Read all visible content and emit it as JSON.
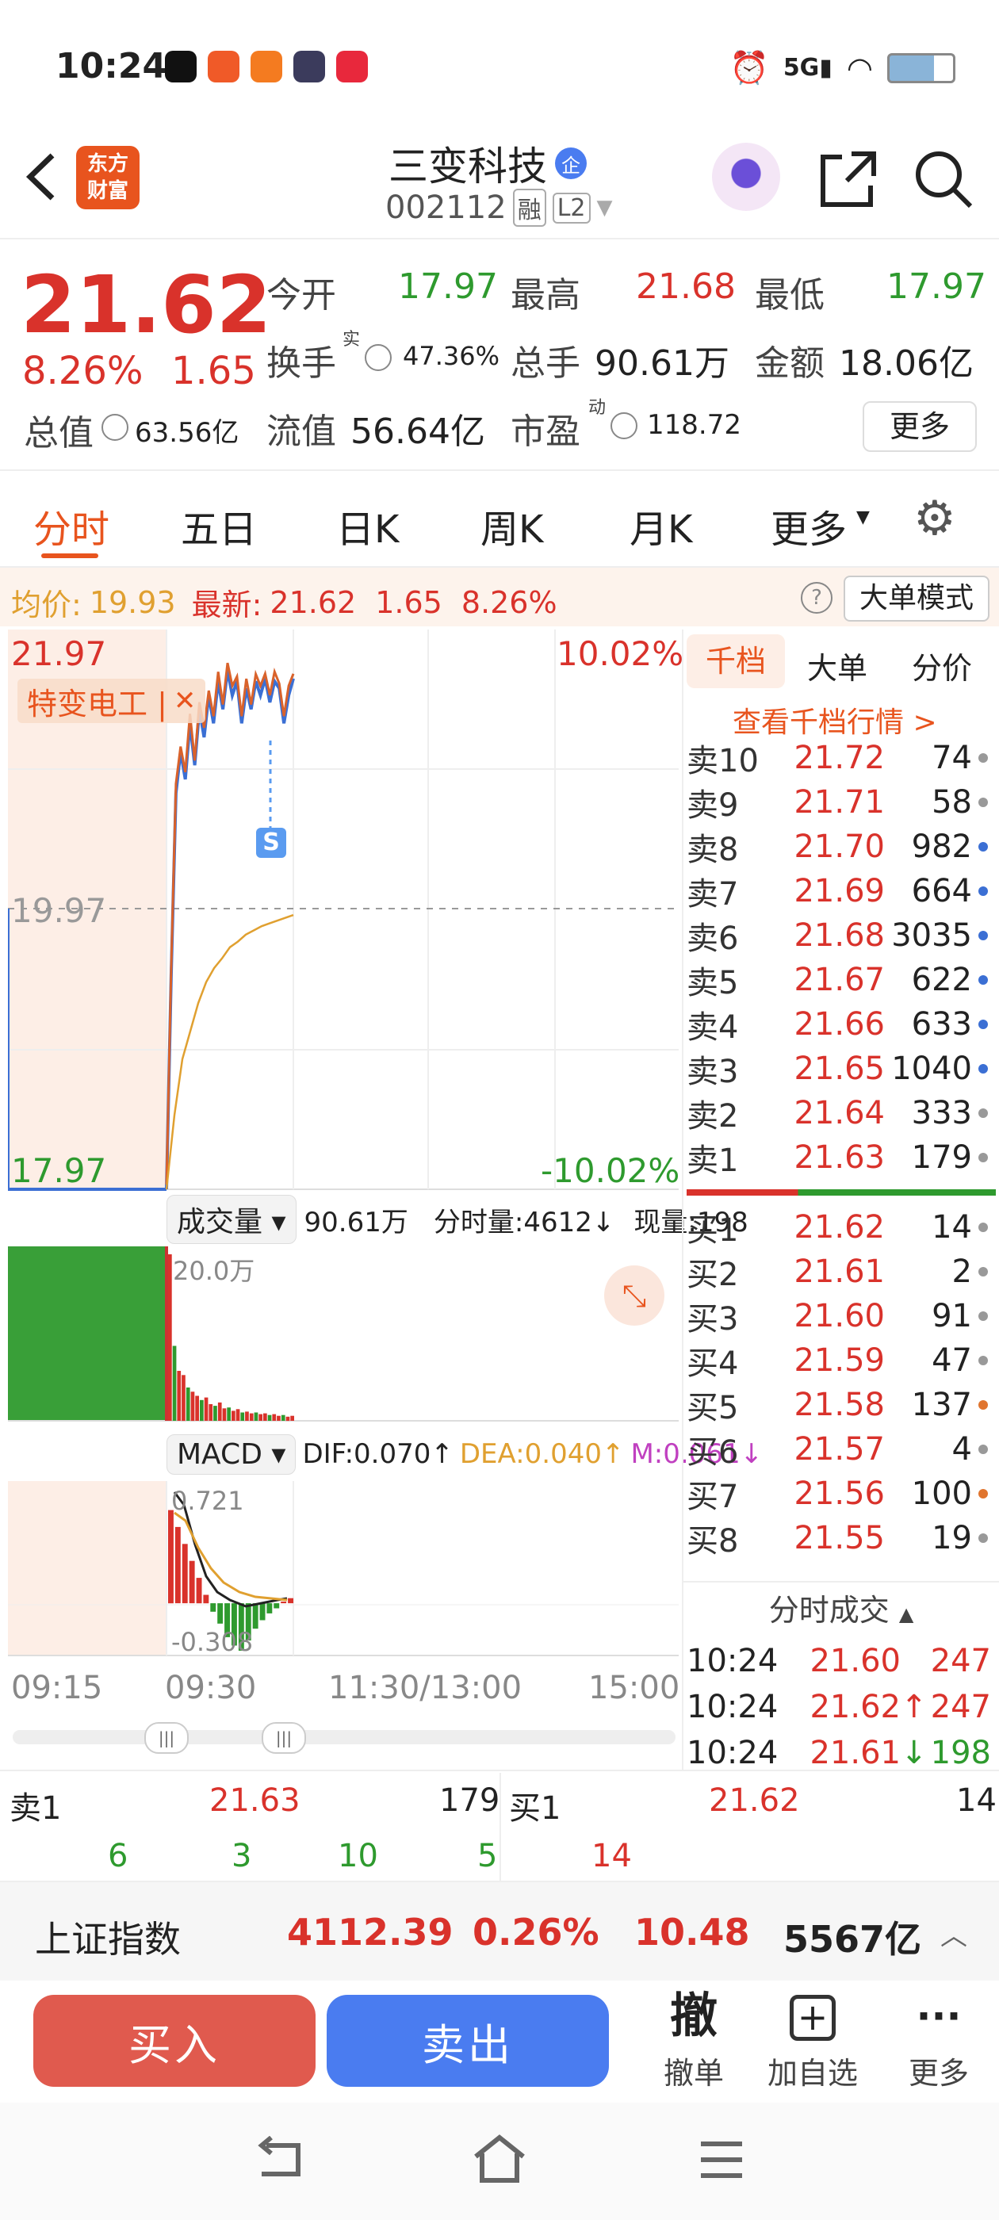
{
  "status_bar": {
    "time": "10:24",
    "app_icons": [
      "douyin-icon",
      "app-red-icon",
      "app-orange-icon",
      "k-app-icon",
      "xiaohongshu-icon"
    ],
    "right_icons": [
      "alarm-icon",
      "signal-5g-icon",
      "wifi-icon",
      "battery-icon"
    ]
  },
  "header": {
    "brand_line1": "东方",
    "brand_line2": "财富",
    "stock_name": "三变科技",
    "badge": "企",
    "code": "002112",
    "tag1": "融",
    "tag2": "L2"
  },
  "quote": {
    "price": "21.62",
    "pct": "8.26%",
    "change": "1.65",
    "open_label": "今开",
    "open": "17.97",
    "high_label": "最高",
    "high": "21.68",
    "low_label": "最低",
    "low": "17.97",
    "turnover_label": "换手",
    "turnover_sup": "实",
    "turnover": "47.36%",
    "volume_label": "总手",
    "volume": "90.61万",
    "amount_label": "金额",
    "amount": "18.06亿",
    "mcap_label": "总值",
    "mcap": "63.56亿",
    "float_label": "流值",
    "float": "56.64亿",
    "pe_label": "市盈",
    "pe_sup": "动",
    "pe": "118.72",
    "more": "更多"
  },
  "tabs": [
    "分时",
    "五日",
    "日K",
    "周K",
    "月K",
    "更多"
  ],
  "tab_active": 0,
  "info_bar": {
    "avg_label": "均价:",
    "avg": "19.93",
    "latest_label": "最新:",
    "latest": "21.62",
    "latest_change": "1.65",
    "latest_pct": "8.26%",
    "mode_button": "大单模式"
  },
  "chart": {
    "top_price": "21.97",
    "mid_price": "19.97",
    "bottom_price": "17.97",
    "top_pct": "10.02%",
    "bottom_pct": "-10.02%",
    "related_tag": "特变电工 |",
    "signal": "S",
    "x_labels": [
      "09:15",
      "09:30",
      "11:30/13:00",
      "15:00"
    ]
  },
  "chart_data": [
    {
      "type": "line",
      "title": "",
      "series": [
        {
          "name": "",
          "x": [
            "09:30",
            "09:32",
            "09:34",
            "09:36",
            "09:38",
            "09:40",
            "09:42",
            "09:44",
            "09:46",
            "09:48",
            "09:50",
            "09:52",
            "09:54",
            "09:56",
            "09:58",
            "10:00",
            "10:02",
            "10:04",
            "10:06",
            "10:08",
            "10:10",
            "10:12",
            "10:14",
            "10:16",
            "10:18",
            "10:20",
            "10:22",
            "10:24"
          ],
          "values": [
            17.97,
            19.5,
            20.8,
            21.1,
            20.9,
            21.3,
            21.0,
            21.4,
            21.2,
            21.5,
            21.3,
            21.6,
            21.4,
            21.68,
            21.5,
            21.6,
            21.3,
            21.55,
            21.4,
            21.6,
            21.5,
            21.62,
            21.45,
            21.6,
            21.55,
            21.3,
            21.5,
            21.62
          ]
        },
        {
          "name": "",
          "x": [
            "09:30",
            "09:32",
            "09:34",
            "09:36",
            "09:38",
            "09:40",
            "09:44",
            "09:48",
            "09:52",
            "09:56",
            "10:00",
            "10:04",
            "10:08",
            "10:12",
            "10:16",
            "10:20",
            "10:24"
          ],
          "values": [
            17.97,
            18.5,
            18.9,
            19.1,
            19.3,
            19.45,
            19.55,
            19.62,
            19.7,
            19.74,
            19.79,
            19.82,
            19.85,
            19.87,
            19.89,
            19.91,
            19.93
          ]
        }
      ],
      "ylim": [
        17.97,
        21.97
      ],
      "yticks": [
        "21.97",
        "19.97",
        "17.97"
      ]
    },
    {
      "type": "bar",
      "title": "成交量",
      "total": "90.61万",
      "max_label": "20.0万",
      "values": [
        20.0,
        9.0,
        6.0,
        5.5,
        4.0,
        3.5,
        3.0,
        2.5,
        2.8,
        2.0,
        1.8,
        2.2,
        1.5,
        1.6,
        1.2,
        1.4,
        1.0,
        1.1,
        0.9,
        1.0,
        0.8,
        0.9,
        0.7,
        0.8,
        0.6,
        0.7,
        0.5,
        0.6
      ],
      "ylim": [
        0,
        20.0
      ]
    },
    {
      "type": "bar",
      "title": "MACD",
      "max_label": "0.721",
      "min_label": "-0.308",
      "values": [
        0.55,
        0.45,
        0.35,
        0.25,
        0.15,
        0.05,
        -0.05,
        -0.12,
        -0.2,
        -0.25,
        -0.28,
        -0.22,
        -0.15,
        -0.1,
        -0.06,
        -0.03,
        0.01,
        0.03
      ],
      "ylim": [
        -0.308,
        0.721
      ]
    }
  ],
  "volume_bar": {
    "label": "成交量",
    "total": "90.61万",
    "fenshi": "分时量:4612↓",
    "current": "现量:198",
    "max": "20.0万"
  },
  "macd_bar": {
    "label": "MACD",
    "dif": "DIF:0.070↑",
    "dea": "DEA:0.040↑",
    "m": "M:0.061↓",
    "top": "0.721",
    "bottom": "-0.308"
  },
  "orderbook": {
    "tabs": [
      "千档",
      "大单",
      "分价"
    ],
    "link": "查看千档行情 >",
    "asks": [
      {
        "label": "卖10",
        "price": "21.72",
        "vol": "74",
        "dot": "#999"
      },
      {
        "label": "卖9",
        "price": "21.71",
        "vol": "58",
        "dot": "#999"
      },
      {
        "label": "卖8",
        "price": "21.70",
        "vol": "982",
        "dot": "#3b6fd4"
      },
      {
        "label": "卖7",
        "price": "21.69",
        "vol": "664",
        "dot": "#3b6fd4"
      },
      {
        "label": "卖6",
        "price": "21.68",
        "vol": "3035",
        "dot": "#3b6fd4"
      },
      {
        "label": "卖5",
        "price": "21.67",
        "vol": "622",
        "dot": "#3b6fd4"
      },
      {
        "label": "卖4",
        "price": "21.66",
        "vol": "633",
        "dot": "#3b6fd4"
      },
      {
        "label": "卖3",
        "price": "21.65",
        "vol": "1040",
        "dot": "#3b6fd4"
      },
      {
        "label": "卖2",
        "price": "21.64",
        "vol": "333",
        "dot": "#999"
      },
      {
        "label": "卖1",
        "price": "21.63",
        "vol": "179",
        "dot": "#999"
      }
    ],
    "bids": [
      {
        "label": "买1",
        "price": "21.62",
        "vol": "14",
        "dot": "#999"
      },
      {
        "label": "买2",
        "price": "21.61",
        "vol": "2",
        "dot": "#999"
      },
      {
        "label": "买3",
        "price": "21.60",
        "vol": "91",
        "dot": "#999"
      },
      {
        "label": "买4",
        "price": "21.59",
        "vol": "47",
        "dot": "#999"
      },
      {
        "label": "买5",
        "price": "21.58",
        "vol": "137",
        "dot": "#e0752f"
      },
      {
        "label": "买6",
        "price": "21.57",
        "vol": "4",
        "dot": "#999"
      },
      {
        "label": "买7",
        "price": "21.56",
        "vol": "100",
        "dot": "#e0752f"
      },
      {
        "label": "买8",
        "price": "21.55",
        "vol": "19",
        "dot": "#999"
      }
    ],
    "ticks_title": "分时成交",
    "ticks": [
      {
        "time": "10:24",
        "price": "21.60",
        "arrow": "",
        "vol": "247",
        "vol_color": "#d9322b"
      },
      {
        "time": "10:24",
        "price": "21.62",
        "arrow": "↑",
        "vol": "247",
        "vol_color": "#d9322b"
      },
      {
        "time": "10:24",
        "price": "21.61",
        "arrow": "↓",
        "vol": "198",
        "vol_color": "#2e9a2e"
      }
    ]
  },
  "queue": {
    "sell_label": "卖1",
    "sell_price": "21.63",
    "sell_vol": "179",
    "buy_label": "买1",
    "buy_price": "21.62",
    "buy_vol": "14",
    "sell_queue": [
      "6",
      "3",
      "10",
      "5"
    ],
    "buy_queue": [
      "14"
    ]
  },
  "index_bar": {
    "name": "上证指数",
    "value": "4112.39",
    "pct": "0.26%",
    "change": "10.48",
    "amount": "5567亿"
  },
  "bottom_actions": {
    "buy": "买入",
    "sell": "卖出",
    "cancel_icon_text": "撤",
    "cancel": "撤单",
    "add": "加自选",
    "more": "更多"
  },
  "colors": {
    "up": "#d9322b",
    "down": "#2e9a2e",
    "price_line": "#3b6fd4",
    "avg_line": "#e0a030",
    "accent": "#e8541e",
    "buy_btn": "#e05a4e",
    "sell_btn": "#4a7cf0"
  }
}
